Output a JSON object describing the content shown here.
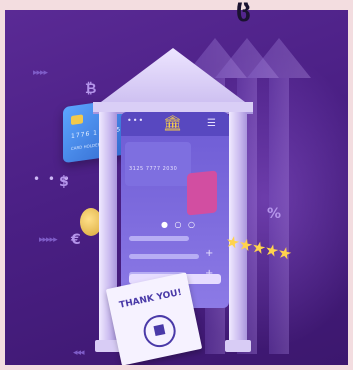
{
  "illustration": {
    "top_glyph": "ც",
    "card": {
      "number": "1776  1 2 7 5",
      "name": "CARD HOLDER"
    },
    "symbols": {
      "bitcoin": "₿",
      "dollar": "$",
      "euro": "€",
      "percent": "%"
    },
    "screen": {
      "mini_card_number": "3125  7777  2030",
      "bank_icon": "🏛"
    },
    "receipt_text": "THANK YOU!",
    "stars": "★★★★★",
    "colors": {
      "background": "#4a1f84",
      "frame": "#f3dde0",
      "accent_gold": "#f2c94c",
      "card_blue": "#3f7fe6",
      "card_pink": "#d24ea1"
    }
  }
}
